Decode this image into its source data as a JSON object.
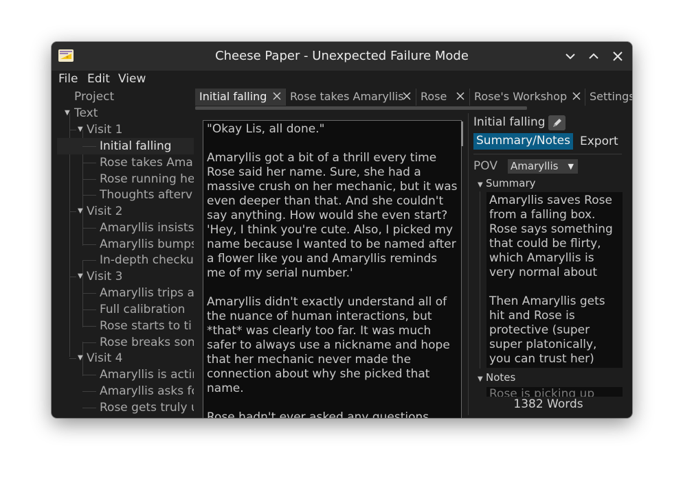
{
  "window": {
    "title": "Cheese Paper - Unexpected Failure Mode"
  },
  "menu": [
    "File",
    "Edit",
    "View"
  ],
  "tree": {
    "project_label": "Project",
    "text_label": "Text",
    "visits": [
      {
        "label": "Visit 1",
        "scenes": [
          "Initial falling",
          "Rose takes Ama",
          "Rose running he",
          "Thoughts afterv"
        ]
      },
      {
        "label": "Visit 2",
        "scenes": [
          "Amaryllis insists",
          "Amaryllis bumps",
          "In-depth checku"
        ]
      },
      {
        "label": "Visit 3",
        "scenes": [
          "Amaryllis trips a",
          "Full calibration",
          "Rose starts to ti",
          "Rose breaks son"
        ]
      },
      {
        "label": "Visit 4",
        "scenes": [
          "Amaryllis is actir",
          "Amaryllis asks fo",
          "Rose gets truly u"
        ]
      }
    ]
  },
  "tabs": [
    "Initial falling",
    "Rose takes Amaryllis",
    "Rose",
    "Rose's Workshop",
    "Settings"
  ],
  "editor": {
    "text": "\"Okay Lis, all done.\"\n\nAmaryllis got a bit of a thrill every time Rose said her name. Sure, she had a massive crush on her mechanic, but it was even deeper than that. And she couldn't say anything. How would she even start? 'Hey, I think you're cute. Also, I picked my name because I wanted to be named after a flower like you and Amaryllis reminds me of my serial number.'\n\nAmaryllis didn't exactly understand all of the nuance of human interactions, but *that* was clearly too far. It was much safer to always use a nickname and hope that her mechanic never made the connection about why she picked that name.\n\nRose hadn't ever asked any questions about"
  },
  "side": {
    "title": "Initial falling",
    "summary_tab": "Summary/Notes",
    "export_tab": "Export",
    "pov_label": "POV",
    "pov_value": "Amaryllis",
    "summary_label": "Summary",
    "summary_text": "Amaryllis saves Rose from a falling box. Rose says something that could be flirty, which Amaryllis is very normal about\n\nThen Amaryllis gets hit and Rose is protective (super super platonically, you can trust her)",
    "notes_label": "Notes",
    "notes_text": "Rose is picking up",
    "word_count": "1382 Words"
  },
  "colors": {
    "accent": "#0a5c85",
    "background": "#1d1d1d",
    "titlebar": "#2c2c2c"
  },
  "icons": [
    "cheese-app-icon",
    "minimize-icon",
    "maximize-icon",
    "close-icon",
    "tab-close-icon",
    "pencil-icon",
    "expand-triangle-icon",
    "dropdown-arrow-icon"
  ]
}
